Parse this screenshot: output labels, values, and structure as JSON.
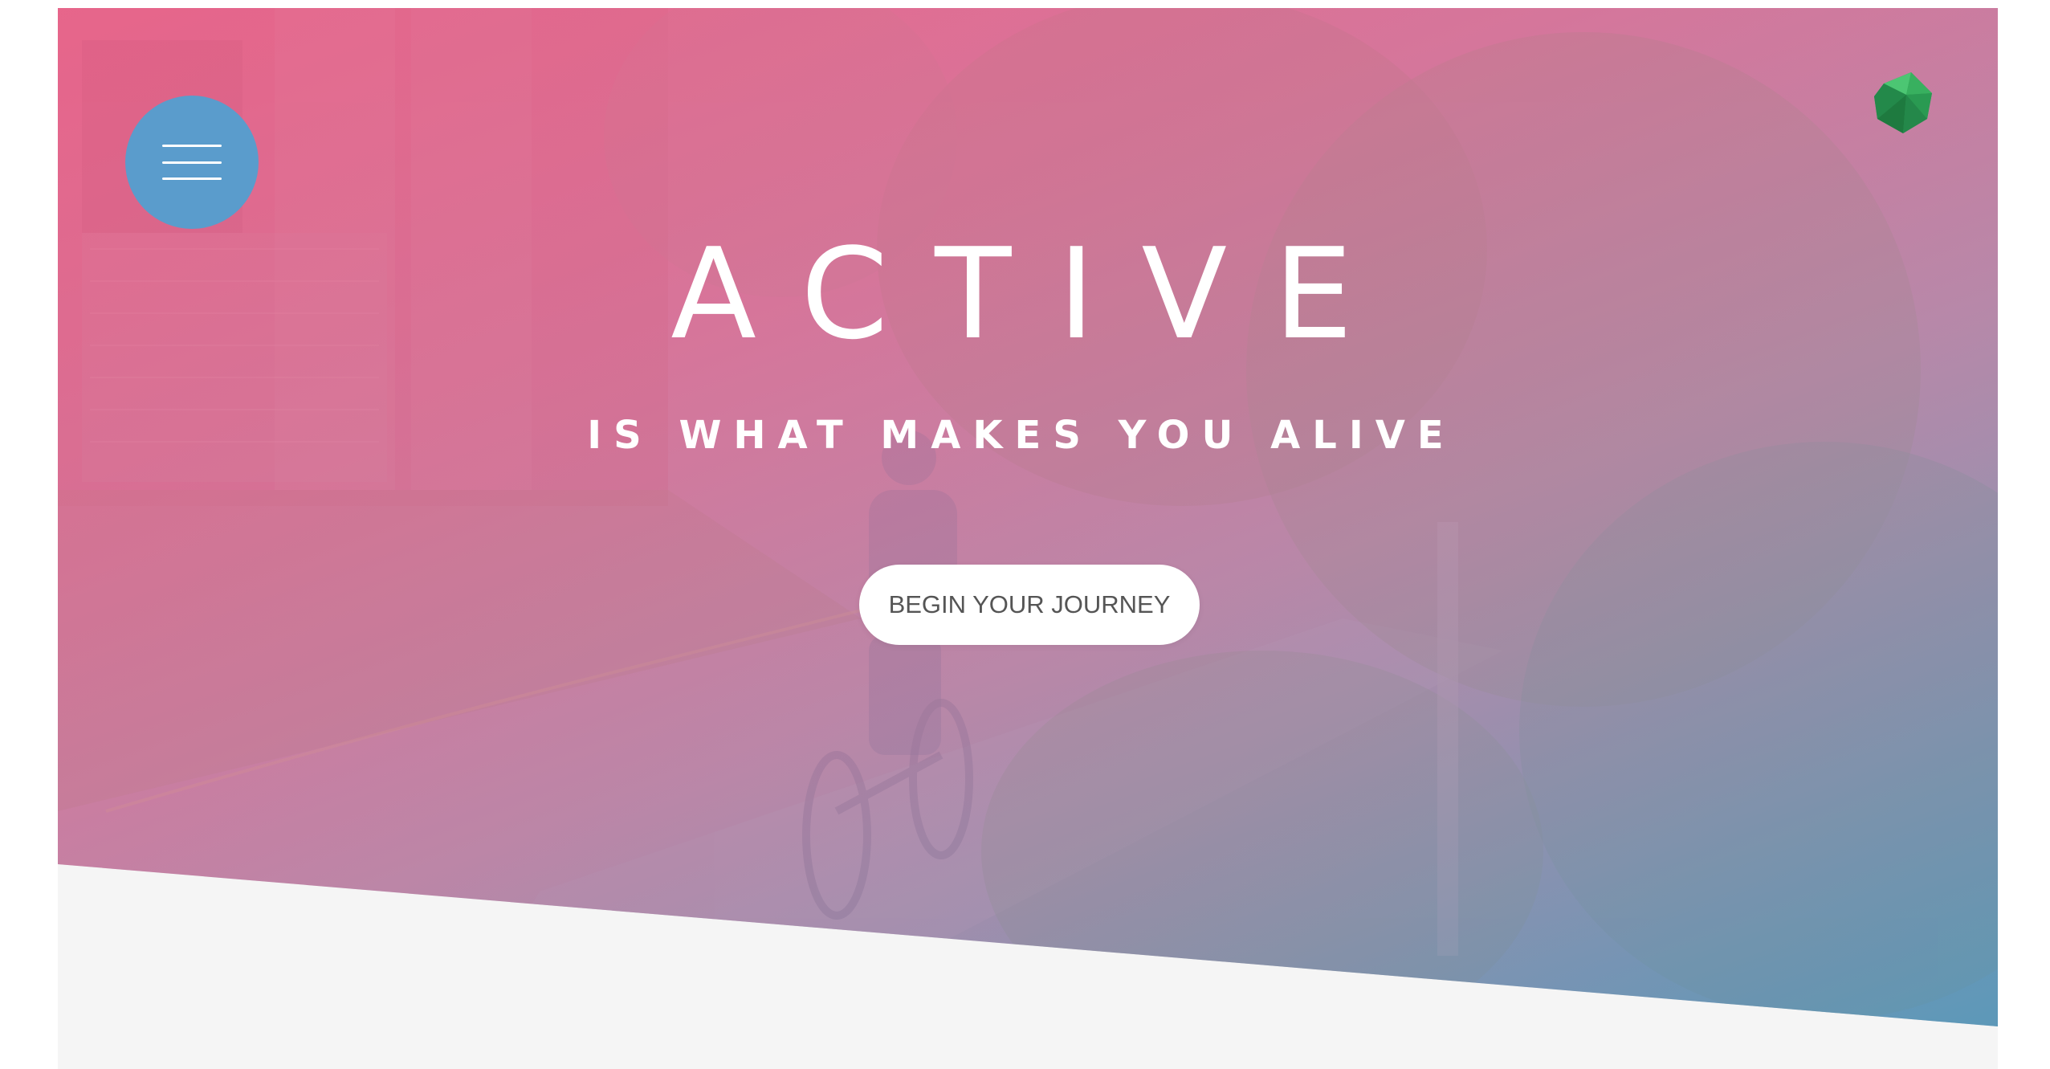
{
  "hero": {
    "headline": "ACTIVE",
    "tagline": "IS WHAT MAKES YOU ALIVE",
    "cta_label": "BEGIN YOUR JOURNEY"
  },
  "nav": {
    "menu_icon": "hamburger-menu-icon"
  },
  "brand": {
    "logo_icon": "green-gem-icon"
  },
  "colors": {
    "menu_button": "#5a9ccc",
    "gradient_start": "#e66a8e",
    "gradient_end": "#5f9ab8",
    "page_background": "#f5f5f5",
    "gem": "#2e9e52"
  }
}
